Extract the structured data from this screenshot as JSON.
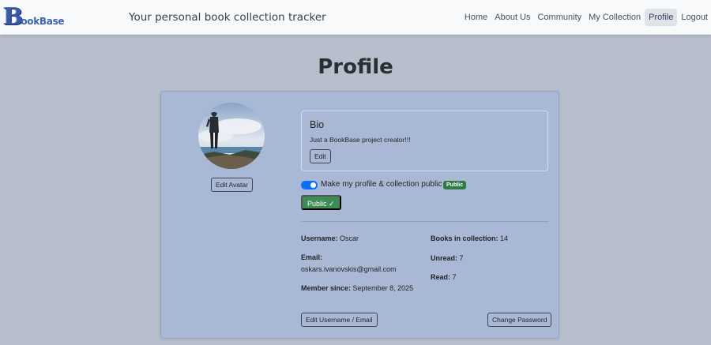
{
  "nav": {
    "logo_letter": "B",
    "logo_text": "ookBase",
    "tagline": "Your personal book collection tracker",
    "links": [
      "Home",
      "About Us",
      "Community",
      "My Collection",
      "Profile",
      "Logout"
    ],
    "active_link": "Profile"
  },
  "page": {
    "title": "Profile"
  },
  "avatar": {
    "edit_label": "Edit Avatar"
  },
  "bio": {
    "title": "Bio",
    "text": "Just a BookBase project creator!!!",
    "edit_label": "Edit"
  },
  "visibility": {
    "toggle_label": "Make my profile & collection public",
    "badge": "Public",
    "public_button": "Public ✓",
    "toggle_on": true
  },
  "details": {
    "username_label": "Username:",
    "username": "Oscar",
    "email_label": "Email:",
    "email": "oskars.ivanovskis@gmail.com",
    "member_since_label": "Member since:",
    "member_since": "September 8, 2025",
    "books_label": "Books in collection:",
    "books": "14",
    "unread_label": "Unread:",
    "unread": "7",
    "read_label": "Read:",
    "read": "7"
  },
  "actions": {
    "edit_username_email": "Edit Username / Email",
    "change_password": "Change Password"
  },
  "colors": {
    "page_bg": "#b8bfcc",
    "card_bg": "#a9b8d4",
    "accent": "#0d6efd",
    "success": "#2f7d46"
  }
}
